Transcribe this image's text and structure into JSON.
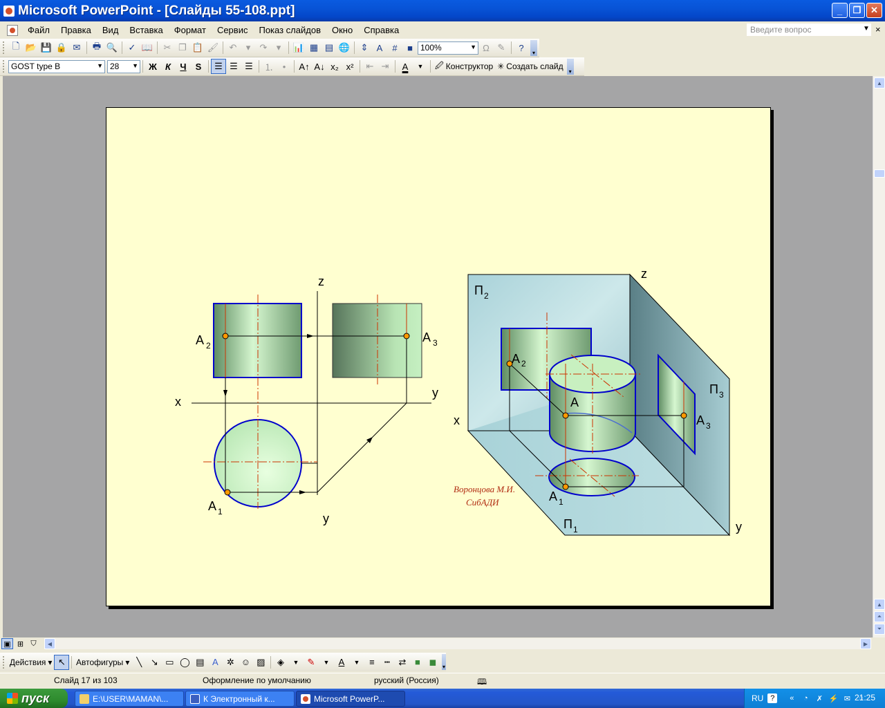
{
  "window": {
    "title": "Microsoft PowerPoint - [Слайды 55-108.ppt]",
    "min_label": "_",
    "max_label": "❐",
    "close_label": "✕"
  },
  "menu": {
    "items": [
      "Файл",
      "Правка",
      "Вид",
      "Вставка",
      "Формат",
      "Сервис",
      "Показ слайдов",
      "Окно",
      "Справка"
    ],
    "ask_placeholder": "Введите вопрос",
    "close_glyph": "×"
  },
  "toolbar": {
    "zoom": "100%",
    "font_name": "GOST type B",
    "font_size": "28",
    "bold": "Ж",
    "italic": "К",
    "underline": "Ч",
    "shadow": "S",
    "designer_label": "Конструктор",
    "new_slide_label": "Создать слайд"
  },
  "slide": {
    "left_labels": {
      "z": "z",
      "x": "x",
      "y_right": "y",
      "y_bottom": "y",
      "a2": "A",
      "a2_sub": "2",
      "a3": "A",
      "a3_sub": "3",
      "a1": "A",
      "a1_sub": "1"
    },
    "right_labels": {
      "z": "z",
      "x": "x",
      "y": "y",
      "p2": "П",
      "p2_sub": "2",
      "p3": "П",
      "p3_sub": "3",
      "p1": "П",
      "p1_sub": "1",
      "a": "A",
      "a2": "A",
      "a2_sub": "2",
      "a3": "A",
      "a3_sub": "3",
      "a1": "A",
      "a1_sub": "1"
    },
    "author_line1": "Воронцова М.И.",
    "author_line2": "СибАДИ",
    "colors": {
      "background": "#ffffd0",
      "outline": "#0000cc",
      "axis": "#cc3300",
      "point": "#ff9900"
    }
  },
  "drawing_toolbar": {
    "actions_label": "Действия",
    "autoshapes_label": "Автофигуры"
  },
  "status": {
    "slide_counter": "Слайд 17 из 103",
    "design": "Оформление по умолчанию",
    "language": "русский (Россия)"
  },
  "taskbar": {
    "start_label": "пуск",
    "items": [
      "E:\\USER\\MAMAN\\...",
      "К Электронный к...",
      "Microsoft PowerP..."
    ],
    "lang": "RU",
    "help": "?",
    "clock": "21:25"
  }
}
